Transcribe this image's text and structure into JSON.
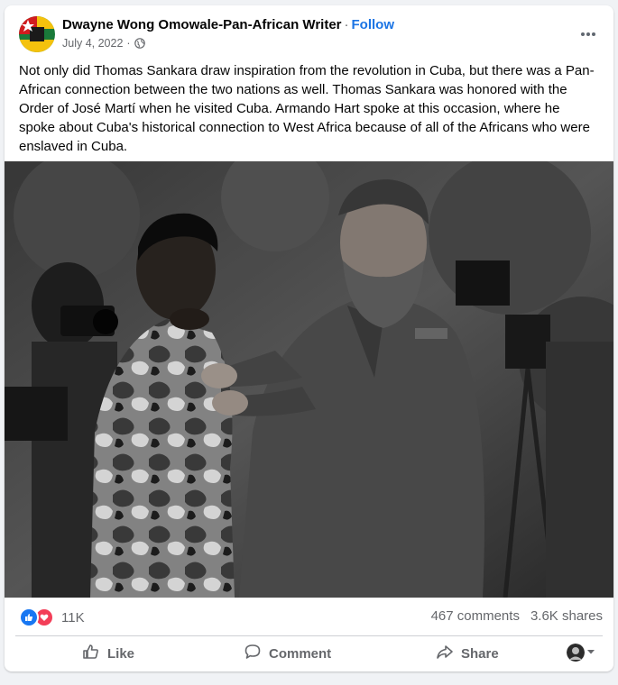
{
  "post": {
    "author": "Dwayne Wong Omowale-Pan-African Writer",
    "separator": "·",
    "follow_label": "Follow",
    "date": "July 4, 2022",
    "date_separator": "·",
    "audience_icon": "globe-icon",
    "more_icon": "more-options-icon",
    "text": "Not only did Thomas Sankara draw inspiration from the revolution in Cuba, but there was a Pan-African connection between the two nations as well. Thomas Sankara was honored with the Order of José Martí when he visited Cuba. Armando Hart spoke at this occasion, where he spoke about Cuba's historical connection to West Africa because of all of the Africans who were enslaved in Cuba."
  },
  "stats": {
    "reaction_count": "11K",
    "reaction_icons": [
      "like-reaction-icon",
      "love-reaction-icon"
    ],
    "comments": "467 comments",
    "shares": "3.6K shares"
  },
  "actions": {
    "like_label": "Like",
    "comment_label": "Comment",
    "share_label": "Share"
  },
  "colors": {
    "link_blue": "#1b74e4",
    "like_blue": "#1877f2",
    "love_red": "#f33e58",
    "secondary_text": "#65676b",
    "background": "#f0f2f5"
  }
}
